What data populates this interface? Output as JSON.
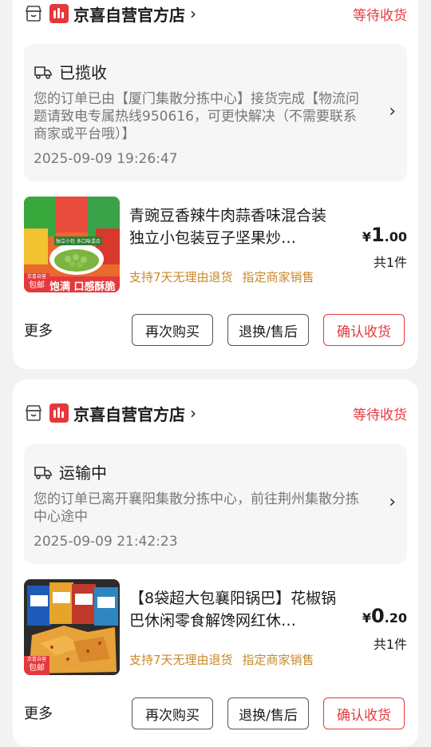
{
  "orders": [
    {
      "store_name": "京喜自营官方店",
      "status": "等待收货",
      "logistics": {
        "title": "已揽收",
        "desc": "您的订单已由【厦门集散分拣中心】接货完成【物流问题请致电专属热线950616，可更快解决（不需要联系商家或平台哦）】",
        "time": "2025-09-09 19:26:47"
      },
      "product": {
        "title": "青豌豆香辣牛肉蒜香味混合装独立小包装豆子坚果炒…",
        "tags": [
          "支持7天无理由退货",
          "指定商家销售"
        ],
        "price_currency": "¥",
        "price_int": "1",
        "price_dec": ".00",
        "qty": "共1件",
        "thumb_label": "包邮",
        "thumb_label_small": "京喜自营",
        "thumb_slogan": "饱满 口感酥脆",
        "thumb_mini": "独立小包 多口味混合"
      },
      "more": "更多",
      "buttons": [
        "再次购买",
        "退换/售后",
        "确认收货"
      ]
    },
    {
      "store_name": "京喜自营官方店",
      "status": "等待收货",
      "logistics": {
        "title": "运输中",
        "desc": "您的订单已离开襄阳集散分拣中心，前往荆州集散分拣中心途中",
        "time": "2025-09-09 21:42:23"
      },
      "product": {
        "title": "【8袋超大包襄阳锅巴】花椒锅巴休闲零食解馋网红休…",
        "tags": [
          "支持7天无理由退货",
          "指定商家销售"
        ],
        "price_currency": "¥",
        "price_int": "0",
        "price_dec": ".20",
        "qty": "共1件",
        "thumb_label": "包邮",
        "thumb_label_small": "京喜自营"
      },
      "more": "更多",
      "buttons": [
        "再次购买",
        "退换/售后",
        "确认收货"
      ]
    }
  ],
  "colors": {
    "accent": "#e4393c",
    "tag": "#c8892a",
    "muted": "#777777"
  }
}
